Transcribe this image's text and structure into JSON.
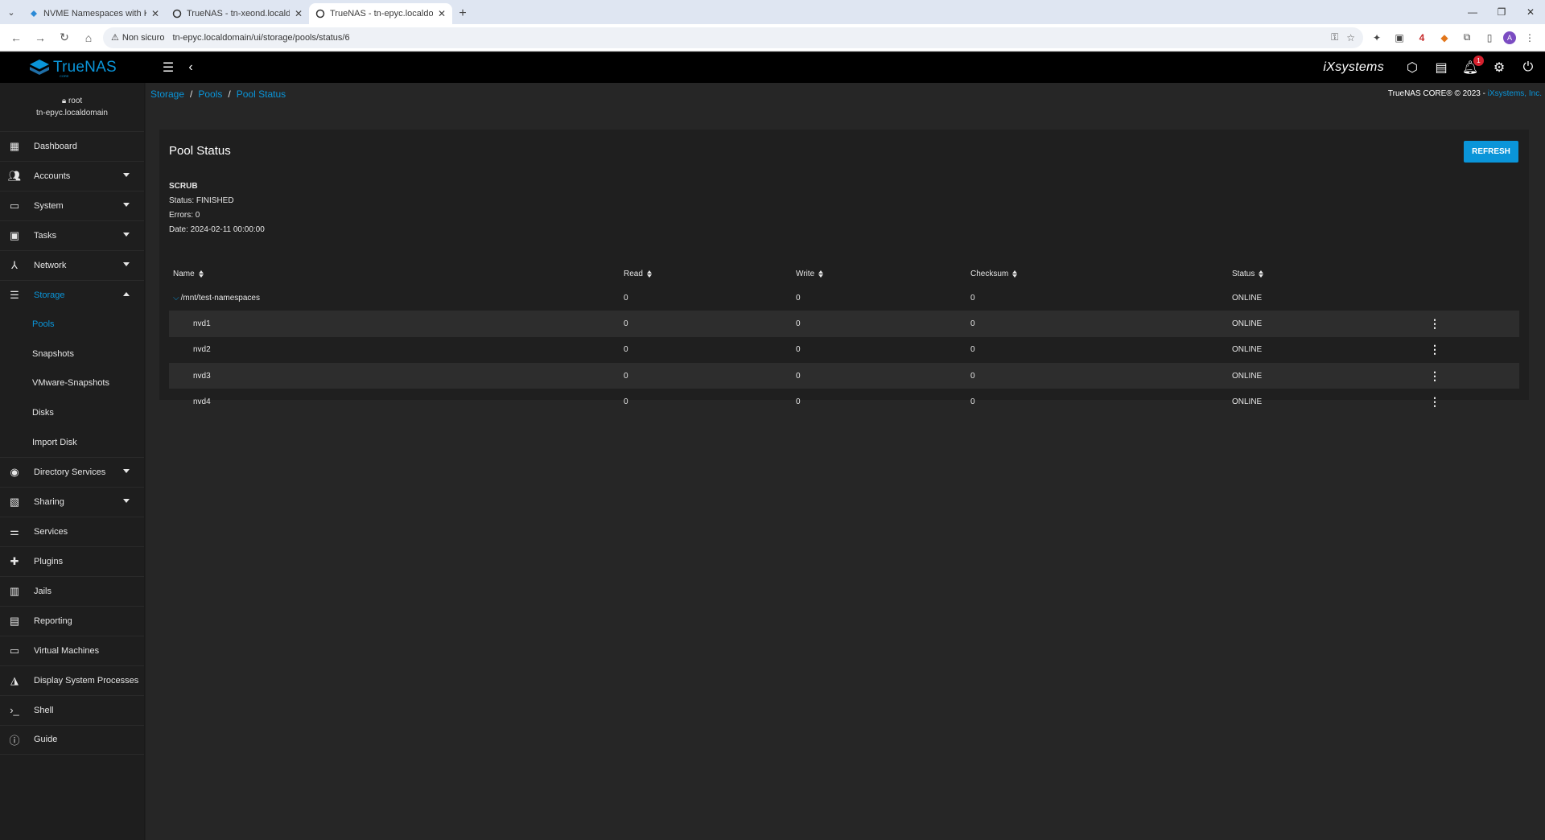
{
  "browser": {
    "tabs": [
      {
        "title": "NVME Namespaces with Kingst",
        "active": false
      },
      {
        "title": "TrueNAS - tn-xeond.localdoma",
        "active": false
      },
      {
        "title": "TrueNAS - tn-epyc.localdomain",
        "active": true
      }
    ],
    "security_label": "Non sicuro",
    "url": "tn-epyc.localdomain/ui/storage/pools/status/6",
    "extension_badge": "4",
    "profile_initial": "A"
  },
  "app": {
    "brand": "TrueNAS",
    "brand_sub": "CORE",
    "vendor_logo": "iXsystems",
    "notification_count": "1"
  },
  "user": {
    "name": "root",
    "host": "tn-epyc.localdomain"
  },
  "sidebar": {
    "items": [
      {
        "label": "Dashboard",
        "icon": "dashboard-icon"
      },
      {
        "label": "Accounts",
        "icon": "accounts-icon"
      },
      {
        "label": "System",
        "icon": "system-icon"
      },
      {
        "label": "Tasks",
        "icon": "tasks-icon"
      },
      {
        "label": "Network",
        "icon": "network-icon"
      },
      {
        "label": "Storage",
        "icon": "storage-icon"
      },
      {
        "label": "Directory Services",
        "icon": "directory-services-icon"
      },
      {
        "label": "Sharing",
        "icon": "sharing-icon"
      },
      {
        "label": "Services",
        "icon": "services-icon"
      },
      {
        "label": "Plugins",
        "icon": "plugins-icon"
      },
      {
        "label": "Jails",
        "icon": "jails-icon"
      },
      {
        "label": "Reporting",
        "icon": "reporting-icon"
      },
      {
        "label": "Virtual Machines",
        "icon": "virtual-machines-icon"
      },
      {
        "label": "Display System Processes",
        "icon": "processes-icon"
      },
      {
        "label": "Shell",
        "icon": "shell-icon"
      },
      {
        "label": "Guide",
        "icon": "guide-icon"
      }
    ],
    "storage_sub": [
      "Pools",
      "Snapshots",
      "VMware-Snapshots",
      "Disks",
      "Import Disk"
    ]
  },
  "breadcrumb": [
    "Storage",
    "Pools",
    "Pool Status"
  ],
  "copyright": {
    "text": "TrueNAS CORE® © 2023 - ",
    "link": "iXsystems, Inc."
  },
  "pool_status": {
    "title": "Pool Status",
    "refresh_label": "REFRESH",
    "scrub": {
      "title": "SCRUB",
      "status": "Status: FINISHED",
      "errors": "Errors: 0",
      "date": "Date: 2024-02-11 00:00:00"
    },
    "columns": [
      "Name",
      "Read",
      "Write",
      "Checksum",
      "Status"
    ],
    "rows": [
      {
        "name": "/mnt/test-namespaces",
        "read": "0",
        "write": "0",
        "checksum": "0",
        "status": "ONLINE"
      },
      {
        "name": "nvd1",
        "read": "0",
        "write": "0",
        "checksum": "0",
        "status": "ONLINE"
      },
      {
        "name": "nvd2",
        "read": "0",
        "write": "0",
        "checksum": "0",
        "status": "ONLINE"
      },
      {
        "name": "nvd3",
        "read": "0",
        "write": "0",
        "checksum": "0",
        "status": "ONLINE"
      },
      {
        "name": "nvd4",
        "read": "0",
        "write": "0",
        "checksum": "0",
        "status": "ONLINE"
      }
    ]
  },
  "colors": {
    "accent": "#0a95d9",
    "background": "#262626",
    "card": "#1f1f1f",
    "topbar": "#000000"
  }
}
